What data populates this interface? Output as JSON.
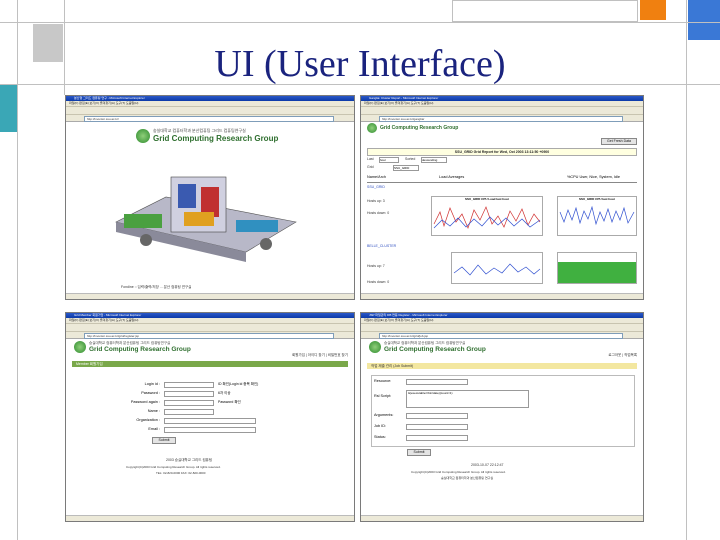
{
  "slide": {
    "title": "UI (User Interface)",
    "colors": {
      "title": "#1a237e",
      "accent_blue": "#3a78d6",
      "accent_orange": "#f08010",
      "accent_teal": "#3aa7b6"
    }
  },
  "shots": {
    "tl": {
      "window_title": "분산형 그리드 컴퓨팅 연구 - Microsoft Internet Explorer",
      "menu": "파일(F)  편집(E)  보기(V)  즐겨찾기(A)  도구(T)  도움말(H)",
      "address": "http://inventor.ssu.ac.kr/",
      "group_kr": "숭실대학교 컴퓨터학과 분산컴퓨팅 그리드 컴퓨팅연구실",
      "group_en": "Grid Computing Research Group",
      "footer": "Fondine :: 입력/출력/저장 ... 분산 컴퓨팅 연구실"
    },
    "tr": {
      "window_title": "Ganglia: Cluster Report - Microsoft Internet Explorer",
      "menu": "파일(F)  편집(E)  보기(V)  즐겨찾기(A)  도구(T)  도움말(H)",
      "address": "http://inventor.ssu.ac.kr/ganglia/",
      "group_en": "Grid Computing Research Group",
      "report_title": "SSU_GRID Grid Report for Wed, Oct 2003 13:11:50 +0900",
      "get_fresh": "Get Fresh Data",
      "last_label": "Last",
      "last_value": "hour",
      "sorted_label": "Sorted",
      "sorted_value": "descending",
      "grid_label": "Grid",
      "grid_value": "SSU_GRID",
      "col_name": "Name/Arch",
      "col_load": "Load Averages",
      "col_cpu": "%CPU User, Nice, System, Idle",
      "cluster1": "SSU_GRID",
      "cluster1_hosts_up": "Hosts up: 3",
      "cluster1_hosts_down": "Hosts down: 0",
      "cluster2": "BELLE_CLUSTER",
      "cluster2_hosts_up": "Hosts up: 7",
      "cluster2_hosts_down": "Hosts down: 0",
      "chart1_title": "SSU_GRID CPU Load last hour",
      "chart2_title": "SSU_GRID CPU last hour"
    },
    "bl": {
      "window_title": "Grid Member 회원가입 - Microsoft Internet Explorer",
      "menu": "파일(F)  편집(E)  보기(V)  즐겨찾기(A)  도구(T)  도움말(H)",
      "address": "http://inventor.ssu.ac.kr/grid/register.jsp",
      "group_kr": "숭실대학교 컴퓨터학과 분산컴퓨팅 그리드 컴퓨팅연구실",
      "group_en": "Grid Computing Research Group",
      "top_right": "회원가입 | 아이디 찾기 | 비밀번호 찾기",
      "form_header": "Member 회원가입",
      "fields": [
        {
          "label": "Login id :",
          "hint": "ID 확인(Login id 중복 확인)"
        },
        {
          "label": "Password :",
          "hint": "6자 이상"
        },
        {
          "label": "Password again :",
          "hint": "Password 확인"
        },
        {
          "label": "Name :",
          "hint": ""
        },
        {
          "label": "Organization :",
          "hint": ""
        },
        {
          "label": "Email :",
          "hint": ""
        }
      ],
      "submit": "Submit",
      "footer_line1": "2003 숭실대학교 그리드 컴퓨팅",
      "footer_line2": "Copyright(C)2003 Grid Computing Research Group. All rights reserved.",
      "footer_line3": "TEL: 02-820-0000  FAX: 02-820-0000"
    },
    "br": {
      "window_title": "JSP 파일관리 DB 연동 Register - Microsoft Internet Explorer",
      "menu": "파일(F)  편집(E)  보기(V)  즐겨찾기(A)  도구(T)  도움말(H)",
      "address": "http://inventor.ssu.ac.kr/grid/job.jsp",
      "group_kr": "숭실대학교 컴퓨터학과 분산컴퓨팅 그리드 컴퓨팅연구실",
      "group_en": "Grid Computing Research Group",
      "top_right": "로그아웃 | 작업목록",
      "form_header": "작업 제출 관리 (Job Submit)",
      "rows": [
        {
          "label": "Resource:",
          "value": ""
        },
        {
          "label": "Rsl Script:",
          "value": "&(executable=/bin/date)(count=1)"
        },
        {
          "label": "Arguments:",
          "value": ""
        },
        {
          "label": "Job ID:",
          "value": ""
        },
        {
          "label": "Status:",
          "value": ""
        }
      ],
      "submit": "Submit",
      "footer_line1": "2003-10-07 22:12:47",
      "footer_line2": "Copyright(C)2003 Grid Computing Research Group. All rights reserved.",
      "footer_line3": "숭실대학교 컴퓨터학과 분산컴퓨팅 연구실"
    }
  }
}
